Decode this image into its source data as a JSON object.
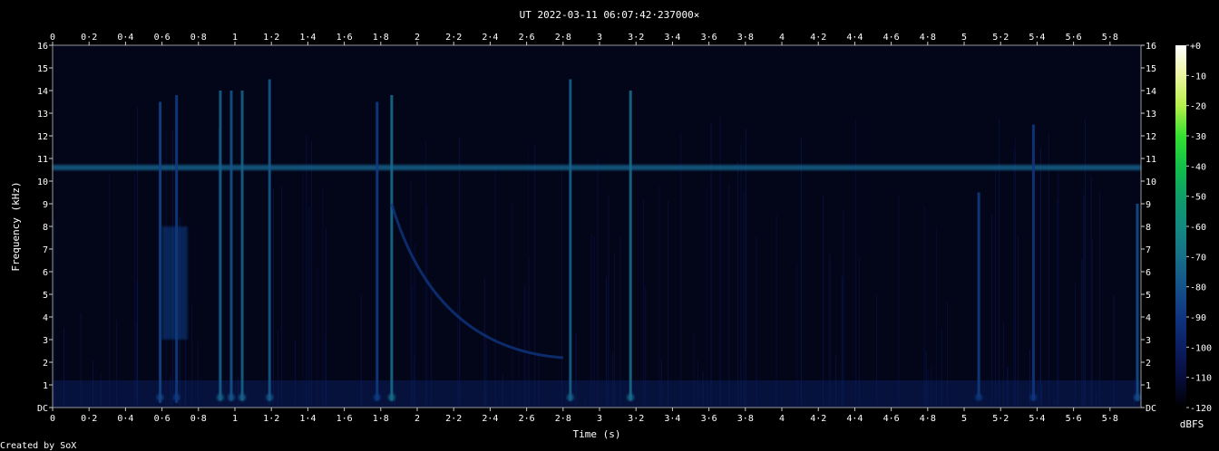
{
  "chart_data": {
    "type": "heatmap",
    "title": "UT 2022-03-11 06:07:42·237000×",
    "xlabel": "Time (s)",
    "ylabel": "Frequency (kHz)",
    "xlim": [
      0,
      5.97
    ],
    "ylim": [
      0,
      16
    ],
    "x_ticks": [
      0,
      0.2,
      0.4,
      0.6,
      0.8,
      1,
      1.2,
      1.4,
      1.6,
      1.8,
      2,
      2.2,
      2.4,
      2.6,
      2.8,
      3,
      3.2,
      3.4,
      3.6,
      3.8,
      4,
      4.2,
      4.4,
      4.6,
      4.8,
      5,
      5.2,
      5.4,
      5.6,
      5.8
    ],
    "x_tick_labels": [
      "0",
      "0·2",
      "0·4",
      "0·6",
      "0·8",
      "1",
      "1·2",
      "1·4",
      "1·6",
      "1·8",
      "2",
      "2·2",
      "2·4",
      "2·6",
      "2·8",
      "3",
      "3·2",
      "3·4",
      "3·6",
      "3·8",
      "4",
      "4·2",
      "4·4",
      "4·6",
      "4·8",
      "5",
      "5·2",
      "5·4",
      "5·6",
      "5·8"
    ],
    "y_ticks": [
      0,
      1,
      2,
      3,
      4,
      5,
      6,
      7,
      8,
      9,
      10,
      11,
      12,
      13,
      14,
      15,
      16
    ],
    "y_tick_labels": [
      "DC",
      "1",
      "2",
      "3",
      "4",
      "5",
      "6",
      "7",
      "8",
      "9",
      "10",
      "11",
      "12",
      "13",
      "14",
      "15",
      "16"
    ],
    "colorbar": {
      "label": "dBFS",
      "range": [
        -120,
        0
      ],
      "ticks": [
        0,
        -10,
        -20,
        -30,
        -40,
        -50,
        -60,
        -70,
        -80,
        -90,
        -100,
        -110,
        -120
      ],
      "tick_labels": [
        "+0",
        "-10",
        "-20",
        "-30",
        "-40",
        "-50",
        "-60",
        "-70",
        "-80",
        "-90",
        "-100",
        "-110",
        "-120"
      ],
      "colors": [
        "#ffffff",
        "#ecf5a0",
        "#b6f04a",
        "#35e030",
        "#12bf48",
        "#0f9e68",
        "#128a80",
        "#177089",
        "#14528a",
        "#0f3580",
        "#0b1e62",
        "#080d3c",
        "#000000"
      ]
    },
    "grid": false,
    "features": [
      {
        "kind": "horizontal_band",
        "freq_khz": 10.6,
        "level_dbfs": -75
      },
      {
        "kind": "vertical_streak",
        "t": 0.59,
        "f_range": [
          0.2,
          13.5
        ],
        "level_dbfs": -85
      },
      {
        "kind": "vertical_streak",
        "t": 0.68,
        "f_range": [
          0.2,
          13.8
        ],
        "level_dbfs": -88
      },
      {
        "kind": "vertical_streak",
        "t": 0.92,
        "f_range": [
          0.3,
          14.0
        ],
        "level_dbfs": -75
      },
      {
        "kind": "vertical_streak",
        "t": 0.98,
        "f_range": [
          0.3,
          14.0
        ],
        "level_dbfs": -80
      },
      {
        "kind": "vertical_streak",
        "t": 1.04,
        "f_range": [
          0.3,
          14.0
        ],
        "level_dbfs": -75
      },
      {
        "kind": "vertical_streak",
        "t": 1.19,
        "f_range": [
          0.3,
          14.5
        ],
        "level_dbfs": -78
      },
      {
        "kind": "vertical_streak",
        "t": 1.78,
        "f_range": [
          0.3,
          13.5
        ],
        "level_dbfs": -88
      },
      {
        "kind": "vertical_streak",
        "t": 1.86,
        "f_range": [
          0.3,
          13.8
        ],
        "level_dbfs": -72
      },
      {
        "kind": "vertical_streak",
        "t": 2.84,
        "f_range": [
          0.3,
          14.5
        ],
        "level_dbfs": -75
      },
      {
        "kind": "vertical_streak",
        "t": 3.17,
        "f_range": [
          0.3,
          14.0
        ],
        "level_dbfs": -72
      },
      {
        "kind": "vertical_streak",
        "t": 5.08,
        "f_range": [
          0.5,
          9.5
        ],
        "level_dbfs": -88
      },
      {
        "kind": "vertical_streak",
        "t": 5.38,
        "f_range": [
          0.3,
          12.5
        ],
        "level_dbfs": -90
      },
      {
        "kind": "vertical_streak",
        "t": 5.95,
        "f_range": [
          0.3,
          9.0
        ],
        "level_dbfs": -82
      },
      {
        "kind": "diffuse_patch",
        "t_range": [
          0.6,
          0.74
        ],
        "f_range": [
          3.0,
          8.0
        ],
        "level_dbfs": -88
      },
      {
        "kind": "whistler_sweep",
        "t_start": 1.86,
        "f_start": 9.0,
        "t_end": 2.8,
        "f_end": 2.2,
        "level_dbfs": -90
      }
    ]
  },
  "footer": {
    "credit": "Created by SoX"
  }
}
